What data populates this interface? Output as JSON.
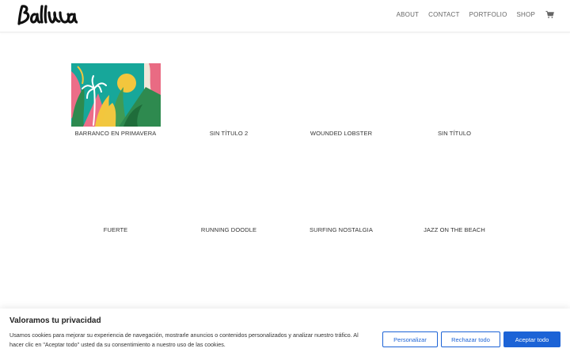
{
  "nav": {
    "items": [
      "ABOUT",
      "CONTACT",
      "PORTFOLIO",
      "SHOP"
    ],
    "cart_icon": "shopping-cart-icon"
  },
  "logo": {
    "icon": "barrera-logo"
  },
  "gallery": {
    "items": [
      {
        "title": "BARRANCO EN PRIMAVERA"
      },
      {
        "title": "SIN TÍTULO 2"
      },
      {
        "title": "WOUNDED LOBSTER"
      },
      {
        "title": "SIN TÍTULO"
      },
      {
        "title": "FUERTE"
      },
      {
        "title": "RUNNING DOODLE"
      },
      {
        "title": "SURFING NOSTALGIA"
      },
      {
        "title": "JAZZ ON THE BEACH"
      }
    ]
  },
  "cookie": {
    "title": "Valoramos tu privacidad",
    "text": "Usamos cookies para mejorar su experiencia de navegación, mostrarle anuncios o contenidos personalizados y analizar nuestro tráfico. Al hacer clic en \"Aceptar todo\" usted da su consentimiento a nuestro uso de las cookies.",
    "customize": "Personalizar",
    "reject": "Rechazar todo",
    "accept": "Aceptar todo",
    "accent": "#1c63d6"
  }
}
